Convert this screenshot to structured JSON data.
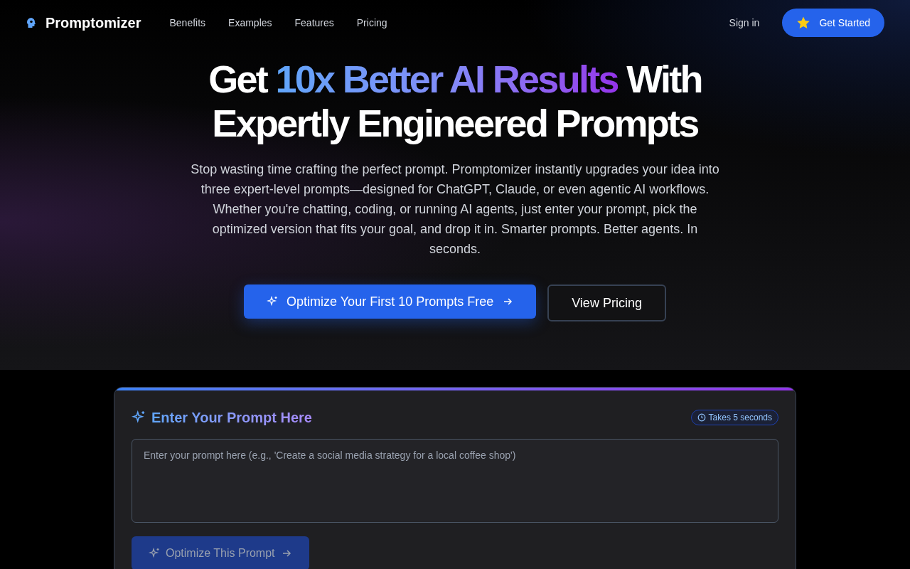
{
  "brand": {
    "name": "Promptomizer"
  },
  "nav": [
    "Benefits",
    "Examples",
    "Features",
    "Pricing"
  ],
  "header_actions": {
    "sign_in": "Sign in",
    "get_started": "Get Started"
  },
  "hero": {
    "headline": [
      {
        "text": "Get ",
        "highlight": false
      },
      {
        "text": "10x Better AI Results",
        "highlight": true
      },
      {
        "text": " With Expertly Engineered Prompts",
        "highlight": false
      }
    ],
    "description": "Stop wasting time crafting the perfect prompt. Promptomizer instantly upgrades your idea into three expert-level prompts—designed for ChatGPT, Claude, or even agentic AI workflows. Whether you're chatting, coding, or running AI agents, just enter your prompt, pick the optimized version that fits your goal, and drop it in. Smarter prompts. Better agents. In seconds.",
    "primary_button": "Optimize Your First 10 Prompts Free",
    "secondary_button": "View Pricing"
  },
  "prompt_card": {
    "title": "Enter Your Prompt Here",
    "badge": "Takes 5 seconds",
    "placeholder": "Enter your prompt here (e.g., 'Create a social media strategy for a local coffee shop')",
    "submit": {
      "label": "Optimize This Prompt",
      "disabled": true
    }
  }
}
